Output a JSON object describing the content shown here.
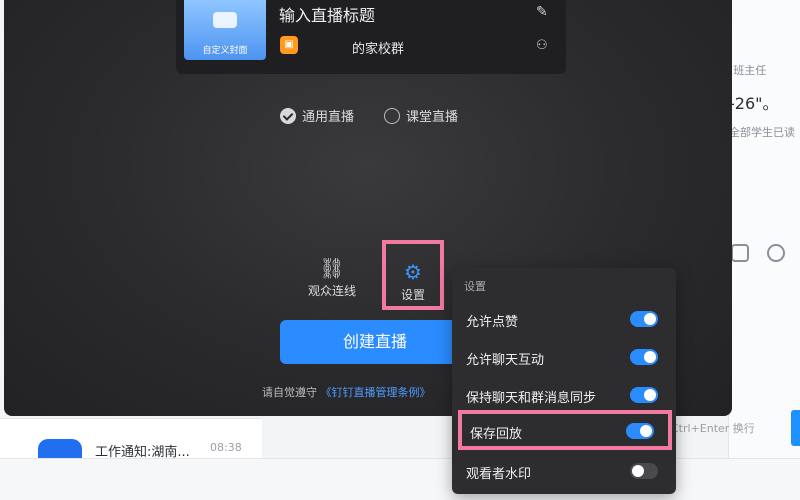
{
  "background": {
    "meta": "(班主任",
    "quote": "-26\"。",
    "read_status": "全部学生已读",
    "shortcut_hint": "Ctrl+Enter 换行",
    "chat_item": {
      "name": "工作通知:湖南...",
      "time": "08:38"
    }
  },
  "live": {
    "cover_label": "自定义封面",
    "title_placeholder": "输入直播标题",
    "group_name": "的家校群",
    "modes": [
      {
        "label": "通用直播",
        "selected": true
      },
      {
        "label": "课堂直播",
        "selected": false
      }
    ],
    "actions": {
      "audience": "观众连线",
      "settings": "设置"
    },
    "create_button": "创建直播",
    "agreement_prefix": "请自觉遵守",
    "agreement_link": "《钉钉直播管理条例》"
  },
  "settings": {
    "header": "设置",
    "options": [
      {
        "label": "允许点赞",
        "on": true
      },
      {
        "label": "允许聊天互动",
        "on": true
      },
      {
        "label": "保持聊天和群消息同步",
        "on": true
      },
      {
        "label": "保存回放",
        "on": true
      },
      {
        "label": "观看者水印",
        "on": false
      }
    ]
  },
  "colors": {
    "accent": "#2b8cff",
    "highlight": "#f07aa0",
    "panel": "#2d2d30"
  }
}
